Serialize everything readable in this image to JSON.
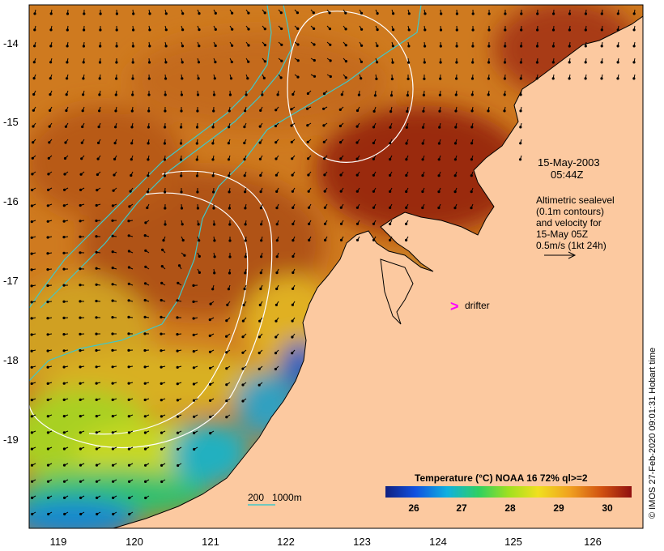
{
  "map": {
    "date": "15-May-2003",
    "time": "05:44Z",
    "legend_lines": [
      "Altimetric sealevel",
      "(0.1m contours)",
      "and velocity for",
      "15-May 05Z",
      "0.5m/s (1kt 24h)"
    ],
    "drifter_label": "drifter",
    "drifter_symbol": ">",
    "depth_labels": {
      "shallow": "200",
      "deep": "1000m"
    },
    "colorbar": {
      "title": "Temperature (°C) NOAA 16 72% ql>=2",
      "ticks": [
        "26",
        "27",
        "28",
        "29",
        "30"
      ]
    },
    "credit": "© IMOS 27-Feb-2020 09:01:31 Hobart time",
    "y_axis_labels": [
      "-14",
      "-15",
      "-16",
      "-17",
      "-18",
      "-19"
    ],
    "x_axis_labels": [
      "119",
      "120",
      "121",
      "122",
      "123",
      "124",
      "125",
      "126"
    ],
    "colors": {
      "land": "#fcc9a0",
      "warm": "#a83212",
      "mid": "#d4781e",
      "cool": "#e8d020",
      "cold": "#20b0d0",
      "coldest": "#1a40b0",
      "isobath": "#40c8c8",
      "contour": "#ffffff",
      "drifter": "#ff00ff"
    }
  }
}
